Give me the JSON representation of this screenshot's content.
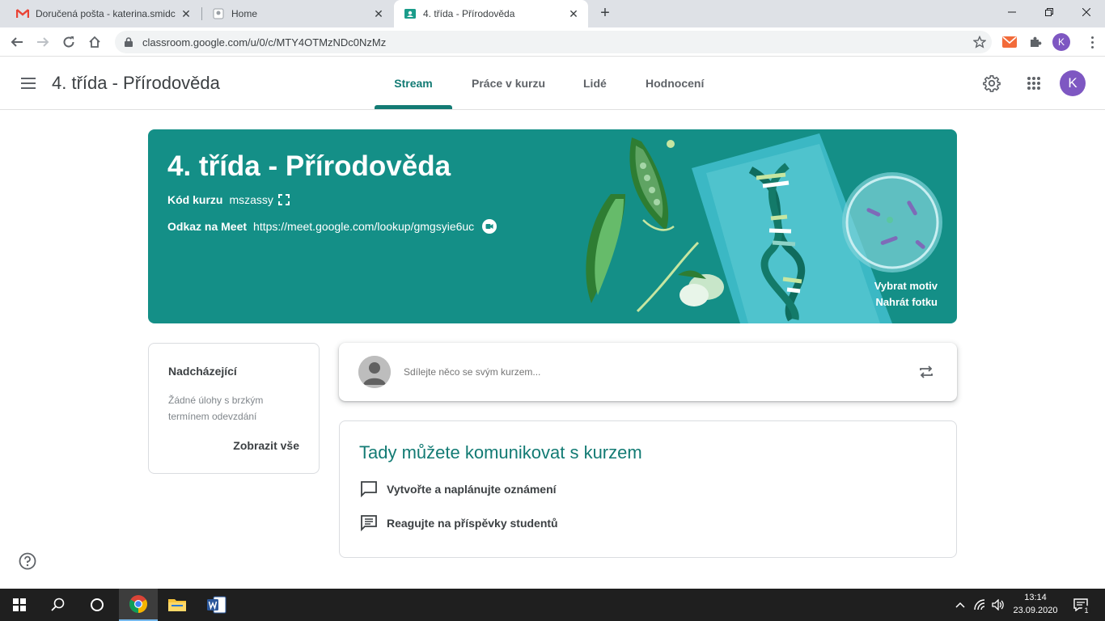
{
  "browser": {
    "tabs": [
      {
        "title": "Doručená pošta - katerina.smidc",
        "icon": "gmail-icon"
      },
      {
        "title": "Home",
        "icon": "page-icon"
      },
      {
        "title": "4. třída - Přírodověda",
        "icon": "classroom-icon"
      }
    ],
    "url": "classroom.google.com/u/0/c/MTY4OTMzNDc0NzMz",
    "profile_initial": "K"
  },
  "header": {
    "course_title": "4. třída - Přírodověda",
    "nav": [
      {
        "label": "Stream"
      },
      {
        "label": "Práce v kurzu"
      },
      {
        "label": "Lidé"
      },
      {
        "label": "Hodnocení"
      }
    ],
    "avatar_initial": "K"
  },
  "banner": {
    "title": "4. třída - Přírodověda",
    "code_label": "Kód kurzu",
    "code_value": "mszassy",
    "meet_label": "Odkaz na Meet",
    "meet_value": "https://meet.google.com/lookup/gmgsyie6uc",
    "select_theme": "Vybrat motiv",
    "upload_photo": "Nahrát fotku",
    "color": "#148f87"
  },
  "upcoming": {
    "title": "Nadcházející",
    "description": "Žádné úlohy s brzkým termínem odevzdání",
    "view_all": "Zobrazit vše"
  },
  "share": {
    "placeholder": "Sdílejte něco se svým kurzem..."
  },
  "communicate": {
    "title": "Tady můžete komunikovat s kurzem",
    "items": [
      {
        "label": "Vytvořte a naplánujte oznámení",
        "icon": "announcement-icon"
      },
      {
        "label": "Reagujte na příspěvky studentů",
        "icon": "comment-icon"
      }
    ]
  },
  "taskbar": {
    "time": "13:14",
    "date": "23.09.2020",
    "notification_count": "1"
  },
  "colors": {
    "accent": "#137b74",
    "avatar": "#7e57c2",
    "taskbar": "#1f1f1f"
  }
}
